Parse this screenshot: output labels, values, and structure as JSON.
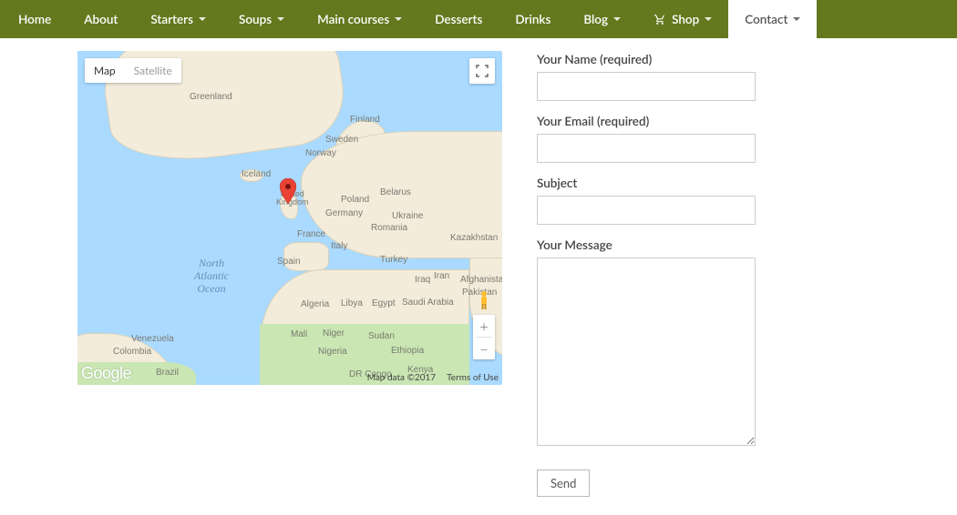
{
  "nav": {
    "items": [
      {
        "label": "Home",
        "dropdown": false,
        "active": false
      },
      {
        "label": "About",
        "dropdown": false,
        "active": false
      },
      {
        "label": "Starters",
        "dropdown": true,
        "active": false
      },
      {
        "label": "Soups",
        "dropdown": true,
        "active": false
      },
      {
        "label": "Main courses",
        "dropdown": true,
        "active": false
      },
      {
        "label": "Desserts",
        "dropdown": false,
        "active": false
      },
      {
        "label": "Drinks",
        "dropdown": false,
        "active": false
      },
      {
        "label": "Blog",
        "dropdown": true,
        "active": false
      },
      {
        "label": "Shop",
        "dropdown": true,
        "active": false,
        "icon": "cart"
      },
      {
        "label": "Contact",
        "dropdown": true,
        "active": true
      }
    ]
  },
  "map": {
    "type_map": "Map",
    "type_satellite": "Satellite",
    "ocean_label": "North\nAtlantic\nOcean",
    "zoom_in": "+",
    "zoom_out": "−",
    "attribution": "Map data ©2017",
    "terms": "Terms of Use",
    "logo": "Google",
    "labels": {
      "greenland": "Greenland",
      "iceland": "Iceland",
      "norway": "Norway",
      "sweden": "Sweden",
      "finland": "Finland",
      "uk": "United\nKingdom",
      "germany": "Germany",
      "poland": "Poland",
      "france": "France",
      "spain": "Spain",
      "italy": "Italy",
      "ukraine": "Ukraine",
      "turkey": "Turkey",
      "kazakhstan": "Kazakhstan",
      "afghanistan": "Afghanistan",
      "pakistan": "Pakistan",
      "iraq": "Iraq",
      "iran": "Iran",
      "saudi": "Saudi Arabia",
      "egypt": "Egypt",
      "libya": "Libya",
      "algeria": "Algeria",
      "mali": "Mali",
      "niger": "Niger",
      "sudan": "Sudan",
      "nigeria": "Nigeria",
      "ethiopia": "Ethiopia",
      "kenya": "Kenya",
      "drcongo": "DR Congo",
      "venezuela": "Venezuela",
      "colombia": "Colombia",
      "brazil": "Brazil",
      "romania": "Romania",
      "belarus": "Belarus"
    }
  },
  "form": {
    "name_label": "Your Name (required)",
    "email_label": "Your Email (required)",
    "subject_label": "Subject",
    "message_label": "Your Message",
    "send_label": "Send",
    "name_value": "",
    "email_value": "",
    "subject_value": "",
    "message_value": ""
  }
}
